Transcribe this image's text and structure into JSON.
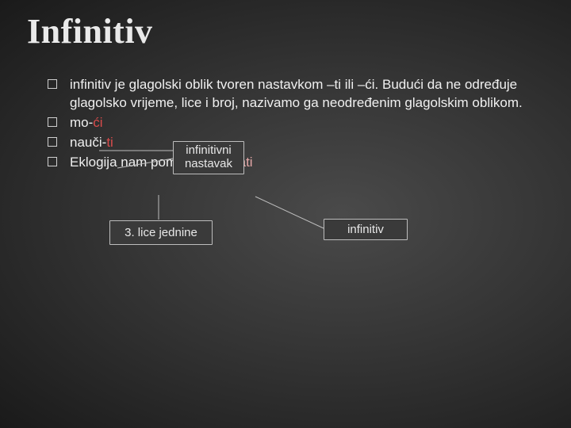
{
  "title": "Infinitiv",
  "bullets": {
    "b1": "infinitiv je glagolski oblik tvoren nastavkom –ti ili –ći. Budući da ne određuje glagolsko vrijeme, lice i broj, nazivamo ga neodređenim glagolskim oblikom.",
    "b2_stem": "mo-",
    "b2_suffix": "ći",
    "b3_stem": "nauči-",
    "b3_suffix": "ti",
    "b4_lead": "Eklogija nam pomaže ",
    "b4_verb": "spoznati"
  },
  "callouts": {
    "infinitivni_l1": "infinitivni",
    "infinitivni_l2": "nastavak",
    "trecelice": "3. lice jednine",
    "infinitiv": "infinitiv"
  }
}
